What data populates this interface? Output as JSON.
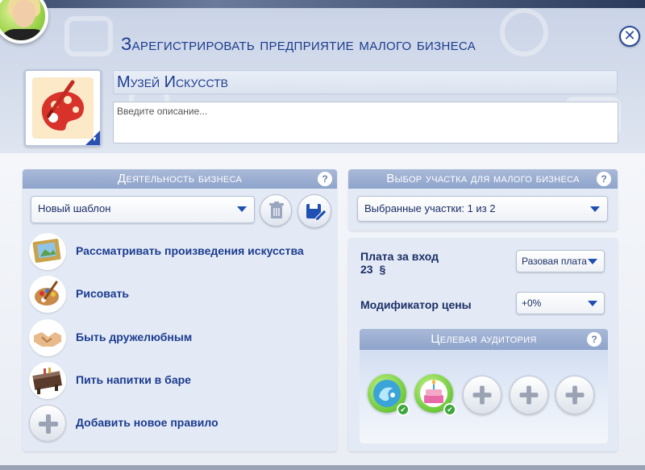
{
  "title": "Зарегистрировать предприятие малого бизнеса",
  "business": {
    "name": "Музей Искусств",
    "description_placeholder": "Введите описание..."
  },
  "activities_panel": {
    "header": "Деятельность бизнеса",
    "template_dropdown": "Новый шаблон",
    "items": [
      {
        "label": "Рассматривать произведения искусства",
        "icon": "painting-frame-icon"
      },
      {
        "label": "Рисовать",
        "icon": "paint-palette-icon"
      },
      {
        "label": "Быть дружелюбным",
        "icon": "handshake-icon"
      },
      {
        "label": "Пить напитки в баре",
        "icon": "bar-counter-icon"
      },
      {
        "label": "Добавить новое правило",
        "icon": "plus-icon"
      }
    ]
  },
  "lot_panel": {
    "header": "Выбор участка для малого бизнеса",
    "lots_dropdown": "Выбранные участки: 1 из 2"
  },
  "fees": {
    "entry_fee_label": "Плата за вход",
    "entry_fee_value": "23",
    "currency_symbol": "§",
    "fee_type_dropdown": "Разовая плата",
    "price_modifier_label": "Модификатор цены",
    "price_modifier_value": "+0%"
  },
  "audience": {
    "header": "Целевая аудитория",
    "slots": [
      {
        "icon": "water-splash-icon",
        "selected": true
      },
      {
        "icon": "birthday-cake-icon",
        "selected": true
      },
      {
        "icon": "plus-icon",
        "selected": false
      },
      {
        "icon": "plus-icon",
        "selected": false
      },
      {
        "icon": "plus-icon",
        "selected": false
      }
    ]
  },
  "help_symbol": "?",
  "close_symbol": "✕",
  "colors": {
    "accent_blue": "#1b3b8f",
    "header_blue": "#8fa4cb",
    "check_green": "#3ba63b"
  }
}
